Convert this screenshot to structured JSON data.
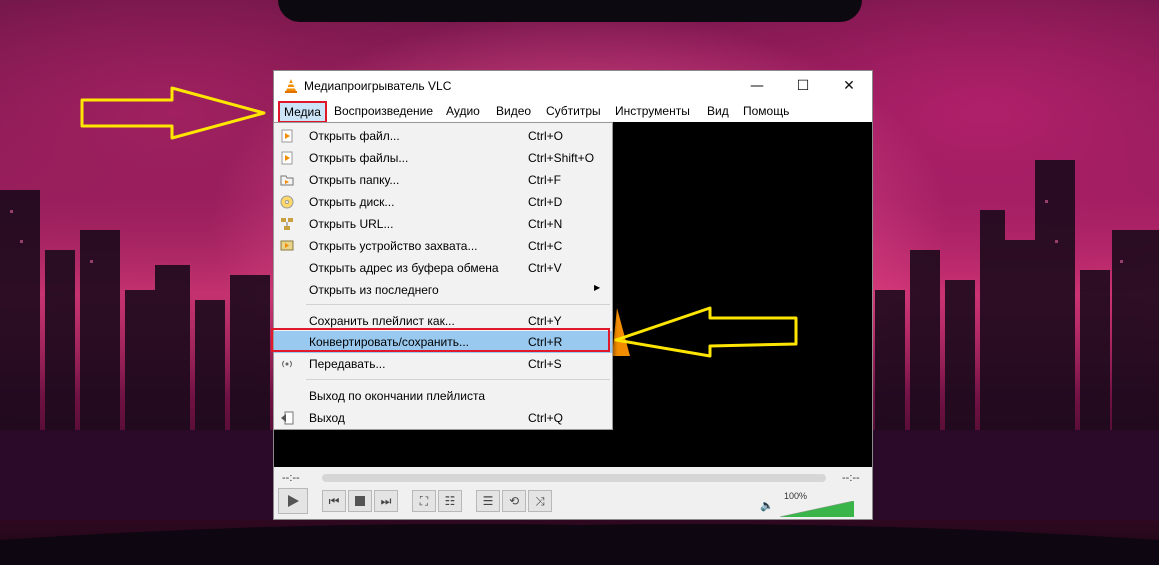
{
  "window": {
    "title": "Медиапроигрыватель VLC",
    "buttons": {
      "minimize": "—",
      "maximize": "☐",
      "close": "✕"
    }
  },
  "menubar": {
    "items": [
      "Медиа",
      "Воспроизведение",
      "Аудио",
      "Видео",
      "Субтитры",
      "Инструменты",
      "Вид",
      "Помощь"
    ],
    "active": "Медиа"
  },
  "media_menu": {
    "items": [
      {
        "label": "Открыть файл...",
        "shortcut": "Ctrl+O",
        "icon": "open-file-icon"
      },
      {
        "label": "Открыть файлы...",
        "shortcut": "Ctrl+Shift+O",
        "icon": "open-files-icon"
      },
      {
        "label": "Открыть папку...",
        "shortcut": "Ctrl+F",
        "icon": "folder-icon"
      },
      {
        "label": "Открыть диск...",
        "shortcut": "Ctrl+D",
        "icon": "disc-icon"
      },
      {
        "label": "Открыть URL...",
        "shortcut": "Ctrl+N",
        "icon": "network-icon"
      },
      {
        "label": "Открыть устройство захвата...",
        "shortcut": "Ctrl+C",
        "icon": "capture-device-icon"
      },
      {
        "label": "Открыть адрес из буфера обмена",
        "shortcut": "Ctrl+V",
        "icon": ""
      },
      {
        "label": "Открыть из последнего",
        "shortcut": "",
        "icon": "",
        "submenu": true
      },
      {
        "label": "Сохранить плейлист как...",
        "shortcut": "Ctrl+Y",
        "icon": ""
      },
      {
        "label": "Конвертировать/сохранить...",
        "shortcut": "Ctrl+R",
        "icon": "",
        "highlighted": true
      },
      {
        "label": "Передавать...",
        "shortcut": "Ctrl+S",
        "icon": "stream-icon"
      },
      {
        "label": "Выход по окончании плейлиста",
        "shortcut": "",
        "icon": ""
      },
      {
        "label": "Выход",
        "shortcut": "Ctrl+Q",
        "icon": "exit-icon"
      }
    ]
  },
  "player": {
    "time_elapsed": "--:--",
    "time_total": "--:--",
    "volume": "100%",
    "volume_level": 1.0
  },
  "colors": {
    "highlight": "#99c9ef",
    "annotation_red": "#e0182c",
    "annotation_arrow": "#ffe600",
    "vlc_orange": "#f28c00",
    "volume_green": "#39b54a"
  }
}
